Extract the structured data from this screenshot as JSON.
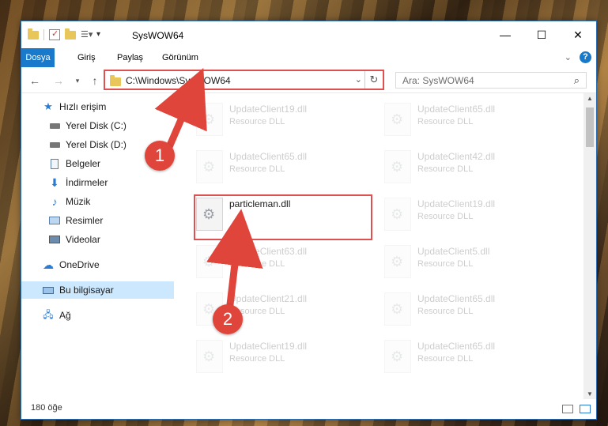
{
  "window": {
    "title": "SysWOW64",
    "controls": {
      "minimize": "—",
      "maximize": "☐",
      "close": "✕"
    }
  },
  "ribbon": {
    "tabs": [
      "Dosya",
      "Giriş",
      "Paylaş",
      "Görünüm"
    ],
    "help": "?"
  },
  "address_bar": {
    "path": "C:\\Windows\\SysWOW64",
    "search_placeholder": "Ara: SysWOW64"
  },
  "nav_pane": {
    "items": [
      {
        "label": "Hızlı erişim",
        "icon": "star-icon",
        "pinned": false
      },
      {
        "label": "Yerel Disk (C:)",
        "icon": "drive-icon",
        "pinned": true
      },
      {
        "label": "Yerel Disk (D:)",
        "icon": "drive-icon",
        "pinned": true
      },
      {
        "label": "Belgeler",
        "icon": "documents-icon",
        "pinned": true
      },
      {
        "label": "İndirmeler",
        "icon": "download-icon",
        "pinned": true
      },
      {
        "label": "Müzik",
        "icon": "music-icon",
        "pinned": true
      },
      {
        "label": "Resimler",
        "icon": "pictures-icon",
        "pinned": true
      },
      {
        "label": "Videolar",
        "icon": "videos-icon",
        "pinned": true
      },
      {
        "label": "OneDrive",
        "icon": "cloud-icon",
        "pinned": false
      },
      {
        "label": "Bu bilgisayar",
        "icon": "computer-icon",
        "pinned": false,
        "selected": true
      },
      {
        "label": "Ağ",
        "icon": "network-icon",
        "pinned": false
      }
    ]
  },
  "files": {
    "left_column": [
      {
        "name": "UpdateClient19.dll",
        "type": "Resource DLL"
      },
      {
        "name": "UpdateClient65.dll",
        "type": "Resource DLL"
      },
      {
        "name": "particleman.dll",
        "type": ""
      },
      {
        "name": "UpdateClient63.dll",
        "type": "Resource DLL"
      },
      {
        "name": "UpdateClient21.dll",
        "type": "Resource DLL"
      },
      {
        "name": "UpdateClient19.dll",
        "type": "Resource DLL"
      }
    ],
    "right_column": [
      {
        "name": "UpdateClient65.dll",
        "type": "Resource DLL"
      },
      {
        "name": "UpdateClient42.dll",
        "type": "Resource DLL"
      },
      {
        "name": "UpdateClient19.dll",
        "type": "Resource DLL"
      },
      {
        "name": "UpdateClient5.dll",
        "type": "Resource DLL"
      },
      {
        "name": "UpdateClient65.dll",
        "type": "Resource DLL"
      },
      {
        "name": "UpdateClient65.dll",
        "type": "Resource DLL"
      }
    ]
  },
  "status_bar": {
    "item_count": "180 öğe"
  },
  "annotations": {
    "callout_1": "1",
    "callout_2": "2",
    "accent": "#e0453c"
  }
}
